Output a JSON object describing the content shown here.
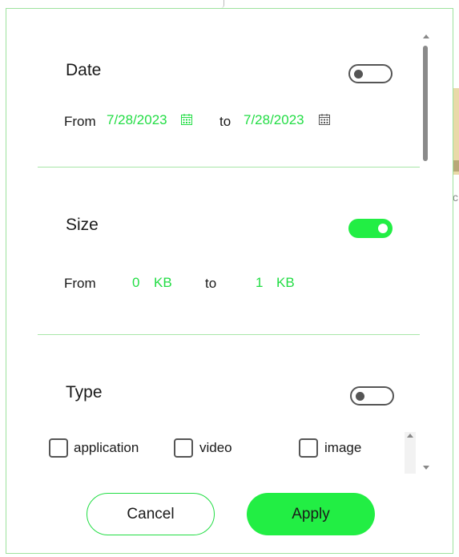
{
  "date": {
    "title": "Date",
    "enabled": false,
    "from_label": "From",
    "from_value": "7/28/2023",
    "to_label": "to",
    "to_value": "7/28/2023"
  },
  "size": {
    "title": "Size",
    "enabled": true,
    "from_label": "From",
    "from_value": "0",
    "from_unit": "KB",
    "to_label": "to",
    "to_value": "1",
    "to_unit": "KB"
  },
  "type": {
    "title": "Type",
    "enabled": false,
    "options": [
      {
        "label": "application",
        "checked": false
      },
      {
        "label": "video",
        "checked": false
      },
      {
        "label": "image",
        "checked": false
      }
    ]
  },
  "buttons": {
    "cancel_label": "Cancel",
    "apply_label": "Apply"
  },
  "colors": {
    "accent": "#22ee44",
    "border": "#9de29d"
  },
  "icons": {
    "calendar": "calendar-icon"
  }
}
